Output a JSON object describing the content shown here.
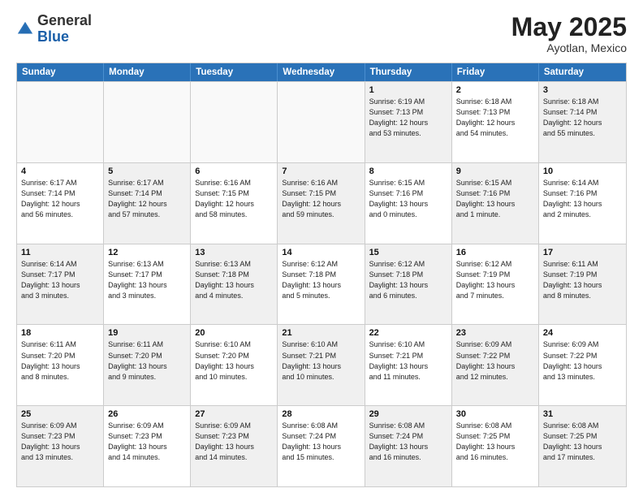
{
  "logo": {
    "general": "General",
    "blue": "Blue"
  },
  "header": {
    "month": "May 2025",
    "location": "Ayotlan, Mexico"
  },
  "weekdays": [
    "Sunday",
    "Monday",
    "Tuesday",
    "Wednesday",
    "Thursday",
    "Friday",
    "Saturday"
  ],
  "rows": [
    [
      {
        "date": "",
        "info": "",
        "empty": true
      },
      {
        "date": "",
        "info": "",
        "empty": true
      },
      {
        "date": "",
        "info": "",
        "empty": true
      },
      {
        "date": "",
        "info": "",
        "empty": true
      },
      {
        "date": "1",
        "info": "Sunrise: 6:19 AM\nSunset: 7:13 PM\nDaylight: 12 hours\nand 53 minutes.",
        "empty": false
      },
      {
        "date": "2",
        "info": "Sunrise: 6:18 AM\nSunset: 7:13 PM\nDaylight: 12 hours\nand 54 minutes.",
        "empty": false
      },
      {
        "date": "3",
        "info": "Sunrise: 6:18 AM\nSunset: 7:14 PM\nDaylight: 12 hours\nand 55 minutes.",
        "empty": false
      }
    ],
    [
      {
        "date": "4",
        "info": "Sunrise: 6:17 AM\nSunset: 7:14 PM\nDaylight: 12 hours\nand 56 minutes.",
        "empty": false
      },
      {
        "date": "5",
        "info": "Sunrise: 6:17 AM\nSunset: 7:14 PM\nDaylight: 12 hours\nand 57 minutes.",
        "empty": false
      },
      {
        "date": "6",
        "info": "Sunrise: 6:16 AM\nSunset: 7:15 PM\nDaylight: 12 hours\nand 58 minutes.",
        "empty": false
      },
      {
        "date": "7",
        "info": "Sunrise: 6:16 AM\nSunset: 7:15 PM\nDaylight: 12 hours\nand 59 minutes.",
        "empty": false
      },
      {
        "date": "8",
        "info": "Sunrise: 6:15 AM\nSunset: 7:16 PM\nDaylight: 13 hours\nand 0 minutes.",
        "empty": false
      },
      {
        "date": "9",
        "info": "Sunrise: 6:15 AM\nSunset: 7:16 PM\nDaylight: 13 hours\nand 1 minute.",
        "empty": false
      },
      {
        "date": "10",
        "info": "Sunrise: 6:14 AM\nSunset: 7:16 PM\nDaylight: 13 hours\nand 2 minutes.",
        "empty": false
      }
    ],
    [
      {
        "date": "11",
        "info": "Sunrise: 6:14 AM\nSunset: 7:17 PM\nDaylight: 13 hours\nand 3 minutes.",
        "empty": false
      },
      {
        "date": "12",
        "info": "Sunrise: 6:13 AM\nSunset: 7:17 PM\nDaylight: 13 hours\nand 3 minutes.",
        "empty": false
      },
      {
        "date": "13",
        "info": "Sunrise: 6:13 AM\nSunset: 7:18 PM\nDaylight: 13 hours\nand 4 minutes.",
        "empty": false
      },
      {
        "date": "14",
        "info": "Sunrise: 6:12 AM\nSunset: 7:18 PM\nDaylight: 13 hours\nand 5 minutes.",
        "empty": false
      },
      {
        "date": "15",
        "info": "Sunrise: 6:12 AM\nSunset: 7:18 PM\nDaylight: 13 hours\nand 6 minutes.",
        "empty": false
      },
      {
        "date": "16",
        "info": "Sunrise: 6:12 AM\nSunset: 7:19 PM\nDaylight: 13 hours\nand 7 minutes.",
        "empty": false
      },
      {
        "date": "17",
        "info": "Sunrise: 6:11 AM\nSunset: 7:19 PM\nDaylight: 13 hours\nand 8 minutes.",
        "empty": false
      }
    ],
    [
      {
        "date": "18",
        "info": "Sunrise: 6:11 AM\nSunset: 7:20 PM\nDaylight: 13 hours\nand 8 minutes.",
        "empty": false
      },
      {
        "date": "19",
        "info": "Sunrise: 6:11 AM\nSunset: 7:20 PM\nDaylight: 13 hours\nand 9 minutes.",
        "empty": false
      },
      {
        "date": "20",
        "info": "Sunrise: 6:10 AM\nSunset: 7:20 PM\nDaylight: 13 hours\nand 10 minutes.",
        "empty": false
      },
      {
        "date": "21",
        "info": "Sunrise: 6:10 AM\nSunset: 7:21 PM\nDaylight: 13 hours\nand 10 minutes.",
        "empty": false
      },
      {
        "date": "22",
        "info": "Sunrise: 6:10 AM\nSunset: 7:21 PM\nDaylight: 13 hours\nand 11 minutes.",
        "empty": false
      },
      {
        "date": "23",
        "info": "Sunrise: 6:09 AM\nSunset: 7:22 PM\nDaylight: 13 hours\nand 12 minutes.",
        "empty": false
      },
      {
        "date": "24",
        "info": "Sunrise: 6:09 AM\nSunset: 7:22 PM\nDaylight: 13 hours\nand 13 minutes.",
        "empty": false
      }
    ],
    [
      {
        "date": "25",
        "info": "Sunrise: 6:09 AM\nSunset: 7:23 PM\nDaylight: 13 hours\nand 13 minutes.",
        "empty": false
      },
      {
        "date": "26",
        "info": "Sunrise: 6:09 AM\nSunset: 7:23 PM\nDaylight: 13 hours\nand 14 minutes.",
        "empty": false
      },
      {
        "date": "27",
        "info": "Sunrise: 6:09 AM\nSunset: 7:23 PM\nDaylight: 13 hours\nand 14 minutes.",
        "empty": false
      },
      {
        "date": "28",
        "info": "Sunrise: 6:08 AM\nSunset: 7:24 PM\nDaylight: 13 hours\nand 15 minutes.",
        "empty": false
      },
      {
        "date": "29",
        "info": "Sunrise: 6:08 AM\nSunset: 7:24 PM\nDaylight: 13 hours\nand 16 minutes.",
        "empty": false
      },
      {
        "date": "30",
        "info": "Sunrise: 6:08 AM\nSunset: 7:25 PM\nDaylight: 13 hours\nand 16 minutes.",
        "empty": false
      },
      {
        "date": "31",
        "info": "Sunrise: 6:08 AM\nSunset: 7:25 PM\nDaylight: 13 hours\nand 17 minutes.",
        "empty": false
      }
    ]
  ]
}
